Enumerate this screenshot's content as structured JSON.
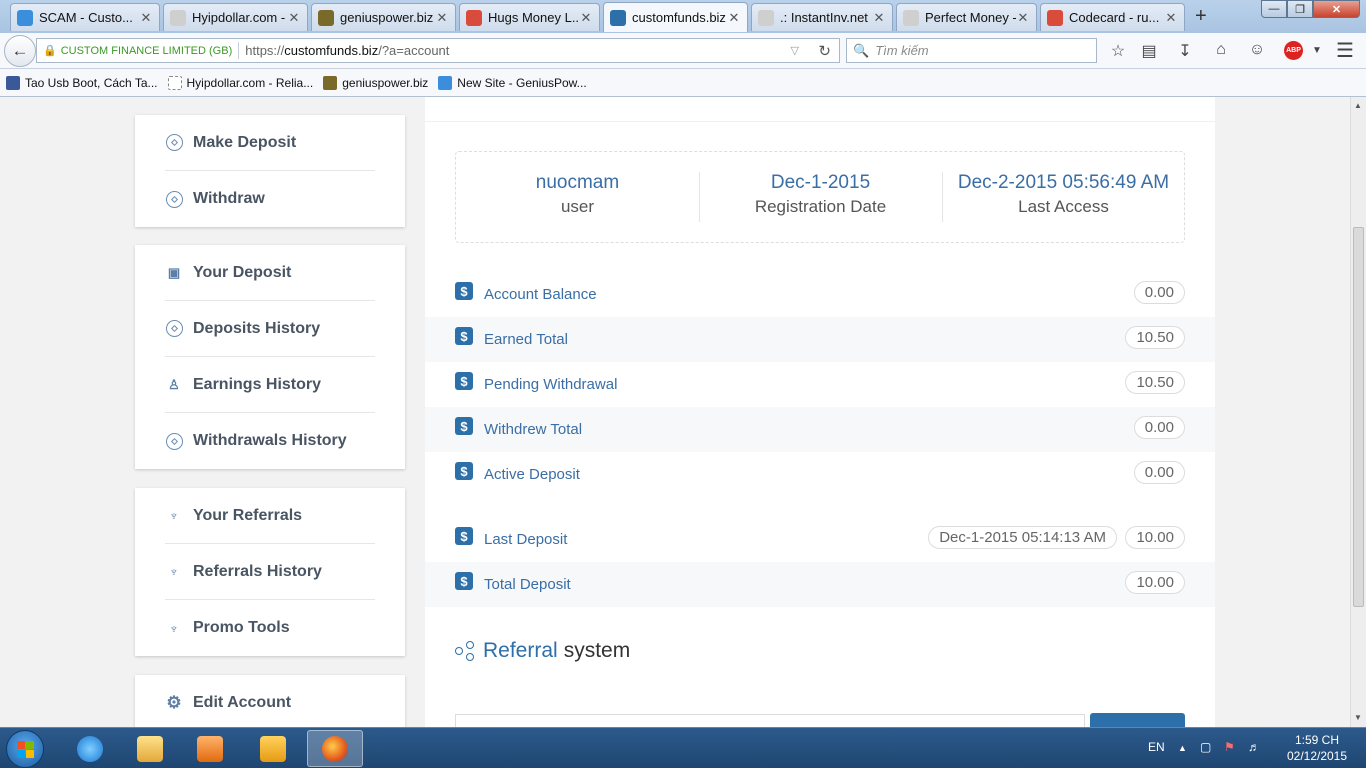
{
  "browser": {
    "tabs": [
      {
        "label": "SCAM - Custo...",
        "icon": "s-circle-icon",
        "color": "#3b8edb"
      },
      {
        "label": "Hyipdollar.com - R...",
        "icon": "blank-page-icon",
        "color": "#cfcfcf"
      },
      {
        "label": "geniuspower.biz",
        "icon": "globe-icon",
        "color": "#7a6a2a"
      },
      {
        "label": "Hugs Money L...",
        "icon": "m-icon",
        "color": "#d94b3b"
      },
      {
        "label": "customfunds.biz",
        "icon": "check-icon",
        "color": "#2d6fa9"
      },
      {
        "label": ".: InstantInv.net :.",
        "icon": "blank-page-icon",
        "color": "#cfcfcf"
      },
      {
        "label": "Perfect Money - W...",
        "icon": "blank-page-icon",
        "color": "#cfcfcf"
      },
      {
        "label": "Codecard - ru...",
        "icon": "gmail-icon",
        "color": "#d94b3b"
      }
    ],
    "active_tab": 4,
    "new_tab": "+",
    "identity": "CUSTOM FINANCE LIMITED (GB)",
    "url_prefix": "https://",
    "url_domain": "customfunds.biz",
    "url_path": "/?a=account",
    "search_placeholder": "Tìm kiếm",
    "bookmarks": [
      {
        "label": "Tao Usb Boot, Cách Ta...",
        "icon": "facebook-icon",
        "color": "#3b5998"
      },
      {
        "label": "Hyipdollar.com - Relia...",
        "icon": "blank-page-icon",
        "color": "#cfcfcf"
      },
      {
        "label": "geniuspower.biz",
        "icon": "globe-icon",
        "color": "#7a6a2a"
      },
      {
        "label": "New Site - GeniusPow...",
        "icon": "s-circle-icon",
        "color": "#3b8edb"
      }
    ]
  },
  "sidebar": {
    "groups": [
      [
        {
          "label": "Make Deposit",
          "icon": "diamond-circle-icon"
        },
        {
          "label": "Withdraw",
          "icon": "diamond-circle-icon"
        }
      ],
      [
        {
          "label": "Your Deposit",
          "icon": "briefcase-icon"
        },
        {
          "label": "Deposits History",
          "icon": "diamond-circle-icon"
        },
        {
          "label": "Earnings History",
          "icon": "person-icon"
        },
        {
          "label": "Withdrawals History",
          "icon": "diamond-circle-icon"
        }
      ],
      [
        {
          "label": "Your Referrals",
          "icon": "referral-person-icon"
        },
        {
          "label": "Referrals History",
          "icon": "referral-person-icon"
        },
        {
          "label": "Promo Tools",
          "icon": "referral-person-icon"
        }
      ],
      [
        {
          "label": "Edit Account",
          "icon": "gear-icon"
        }
      ]
    ]
  },
  "account": {
    "username": "nuocmam",
    "username_label": "user",
    "reg_date": "Dec-1-2015",
    "reg_label": "Registration Date",
    "last_access": "Dec-2-2015 05:56:49 AM",
    "last_access_label": "Last Access"
  },
  "stats": [
    {
      "label": "Account Balance",
      "value": "0.00"
    },
    {
      "label": "Earned Total",
      "value": "10.50"
    },
    {
      "label": "Pending Withdrawal",
      "value": "10.50"
    },
    {
      "label": "Withdrew Total",
      "value": "0.00"
    },
    {
      "label": "Active Deposit",
      "value": "0.00"
    }
  ],
  "deposits": [
    {
      "label": "Last Deposit",
      "value": "10.00",
      "date": "Dec-1-2015 05:14:13 AM"
    },
    {
      "label": "Total Deposit",
      "value": "10.00"
    }
  ],
  "currency_symbol": "$",
  "referral": {
    "title_highlight": "Referral",
    "title_rest": "system"
  },
  "taskbar": {
    "language": "EN",
    "time": "1:59 CH",
    "date": "02/12/2015"
  }
}
